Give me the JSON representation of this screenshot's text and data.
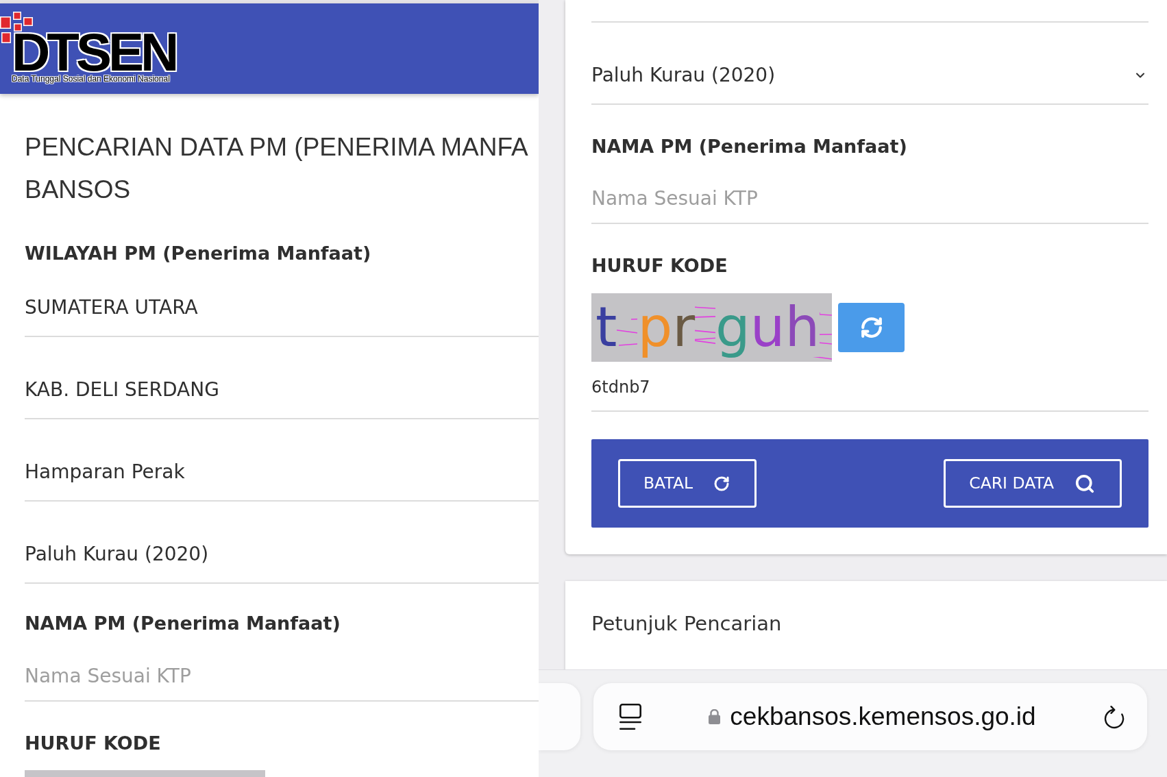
{
  "left_screen": {
    "header": {
      "logo": {
        "title": "DTSEN",
        "subtitle": "Data Tunggal Sosial dan Ekonomi Nasional"
      }
    },
    "title_lines": [
      "PENCARIAN DATA PM (PENERIMA MANFA",
      "BANSOS"
    ],
    "region": {
      "label": "WILAYAH PM (Penerima Manfaat)",
      "selects": [
        {
          "value": "SUMATERA UTARA"
        },
        {
          "value": "KAB. DELI SERDANG"
        },
        {
          "value": "Hamparan Perak"
        },
        {
          "value": "Paluh Kurau (2020)"
        }
      ]
    },
    "name_field": {
      "label": "NAMA PM (Penerima Manfaat)",
      "placeholder": "Nama Sesuai KTP"
    },
    "captcha": {
      "label": "HURUF KODE"
    }
  },
  "right_screen": {
    "form_card": {
      "selects": [
        {
          "value": "Paluh Kurau (2020)"
        }
      ],
      "name_field": {
        "label": "NAMA PM (Penerima Manfaat)",
        "placeholder": "Nama Sesuai KTP"
      },
      "captcha": {
        "label": "HURUF KODE",
        "words": [
          {
            "letters": [
              {
                "char": "t",
                "color": "#3a3fa0"
              }
            ]
          },
          {
            "letters": [
              {
                "char": "p",
                "color": "#f0902a"
              },
              {
                "char": "r",
                "color": "#6a5a44"
              }
            ]
          },
          {
            "letters": [
              {
                "char": "g",
                "color": "#3a9a8a"
              },
              {
                "char": "u",
                "color": "#9a40c8"
              },
              {
                "char": "h",
                "color": "#8c4ab8"
              }
            ]
          }
        ],
        "code_value": "6tdnb7"
      },
      "actions": [
        {
          "kind": "cancel",
          "label": "BATAL"
        },
        {
          "kind": "search",
          "label": "CARI DATA"
        }
      ]
    },
    "help_card": {
      "title": "Petunjuk Pencarian"
    },
    "browser_bar": {
      "url": "cekbansos.kemensos.go.id",
      "secure": true
    }
  }
}
